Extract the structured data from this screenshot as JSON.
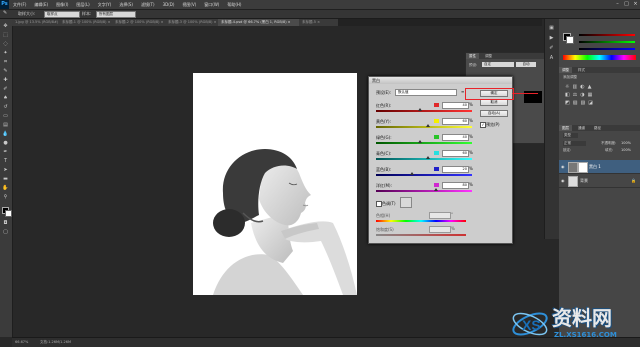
{
  "app": {
    "logo": "Ps",
    "menu": [
      "文件(F)",
      "编辑(E)",
      "图像(I)",
      "图层(L)",
      "文字(Y)",
      "选择(S)",
      "滤镜(T)",
      "3D(D)",
      "视图(V)",
      "窗口(W)",
      "帮助(H)"
    ],
    "window_buttons": [
      "–",
      "□",
      "×"
    ]
  },
  "options": {
    "sample_size_label": "取样大小:",
    "sample_size_value": "取样点",
    "sample_label": "样本:",
    "sample_value": "所有图层"
  },
  "tabs": [
    {
      "label": "1.jpg @ 13.5% (RGB/8#) ×",
      "active": false
    },
    {
      "label": "未标题-1 @ 100% (RGB/8) ×",
      "active": false
    },
    {
      "label": "未标题-2 @ 100% (RGB/8) ×",
      "active": false
    },
    {
      "label": "未标题-3 @ 100% (RGB/8) ×",
      "active": false
    },
    {
      "label": "未标题-4.psd @ 66.7% (黑白 1, RGB/8) ×",
      "active": true
    },
    {
      "label": "未标题-5 ×",
      "active": false
    }
  ],
  "dialog": {
    "title": "黑白",
    "preset_label": "预设(E):",
    "preset_value": "默认值",
    "ok": "确定",
    "cancel": "取消",
    "auto": "自动(A)",
    "preview": "预览(P)",
    "channels": [
      {
        "label": "红色(R):",
        "value": "40",
        "color": "#e0282a"
      },
      {
        "label": "黄色(Y):",
        "value": "60",
        "color": "#f4f000"
      },
      {
        "label": "绿色(G):",
        "value": "40",
        "color": "#28c428"
      },
      {
        "label": "青色(C):",
        "value": "60",
        "color": "#28e0e0"
      },
      {
        "label": "蓝色(B):",
        "value": "20",
        "color": "#2020c8"
      },
      {
        "label": "洋红(M):",
        "value": "80",
        "color": "#d028d0"
      }
    ],
    "tint_label": "色调(T)",
    "hue_label": "色相(H)",
    "hue_unit": "°",
    "saturation_label": "饱和度(S)",
    "saturation_unit": "%"
  },
  "properties": {
    "tab1": "属性",
    "tab2": "调整",
    "preset_label": "预设:",
    "preset_value": "自定",
    "auto_label": "自动"
  },
  "right_panel": {
    "adjust_tab": "调整",
    "styles_tab": "样式",
    "add_adjust_label": "添加调整",
    "layers_tab": "图层",
    "channels_tab": "通道",
    "paths_tab": "路径",
    "kind_label": "类型",
    "blend_mode": "正常",
    "opacity_label": "不透明度:",
    "opacity_value": "100%",
    "lock_label": "锁定:",
    "fill_label": "填充:",
    "fill_value": "100%",
    "layers": [
      {
        "name": "黑白 1",
        "selected": true
      },
      {
        "name": "背景",
        "selected": false
      }
    ]
  },
  "status": {
    "zoom": "66.67%",
    "doc": "文档:1.26M/1.26M"
  },
  "watermark": {
    "brand": "资料网",
    "url": "ZL.XS1616.COM"
  },
  "colors": {
    "highlight": "#e8232a",
    "accent": "#31a8ff"
  }
}
